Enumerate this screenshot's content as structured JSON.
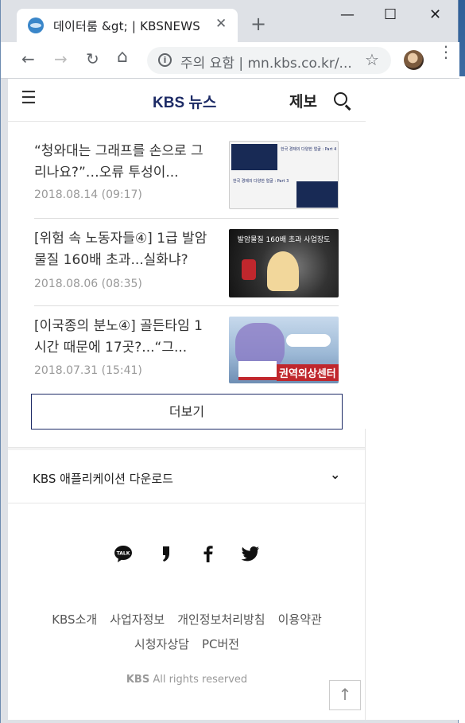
{
  "browser": {
    "tab_title": "데이터룸 &gt; | KBSNEWS",
    "new_tab": "+",
    "close_tab": "✕",
    "minimize": "—",
    "maximize": "☐",
    "close_window": "✕",
    "back": "←",
    "forward": "→",
    "reload": "↻",
    "home": "⌂",
    "info": "i",
    "address": "주의 요함 | mn.kbs.co.kr/...",
    "bookmark": "☆",
    "kebab": "⋮"
  },
  "header": {
    "menu": "☰",
    "logo": "KBS 뉴스",
    "report": "제보"
  },
  "news": [
    {
      "title": "“청와대는 그래프를 손으로 그리나요?”…오류 투성이...",
      "date": "2018.08.14 (09:17)"
    },
    {
      "title": "[위험 속 노동자들④] 1급 발암물질 160배 초과...실화냐?",
      "date": "2018.08.06 (08:35)"
    },
    {
      "title": "[이국종의 분노④] 골든타임 1시간 때문에 17곳?...“그...",
      "date": "2018.07.31 (15:41)"
    }
  ],
  "thumbs": {
    "t1_part4": "한국 경제의 다양한 얼굴 : Part 4",
    "t1_part3": "한국 경제의 다양한 얼굴 : Part 3",
    "t2_caption": "발암물질 160배 초과 사업장도",
    "t3_caption": "권역외상센터"
  },
  "more_button": "더보기",
  "app_download": {
    "label": "KBS 애플리케이션 다운로드",
    "chevron": "⌄"
  },
  "footer": {
    "links": [
      "KBS소개",
      "사업자정보",
      "개인정보처리방침",
      "이용약관",
      "시청자상담",
      "PC버전"
    ],
    "copyright_brand": "KBS",
    "copyright_text": " All rights reserved"
  },
  "to_top": "↑",
  "icons": {
    "talk": "kakaotalk-icon",
    "story": "kakaostory-icon",
    "facebook": "facebook-icon",
    "twitter": "twitter-icon"
  },
  "colors": {
    "brand": "#1d2b66"
  }
}
